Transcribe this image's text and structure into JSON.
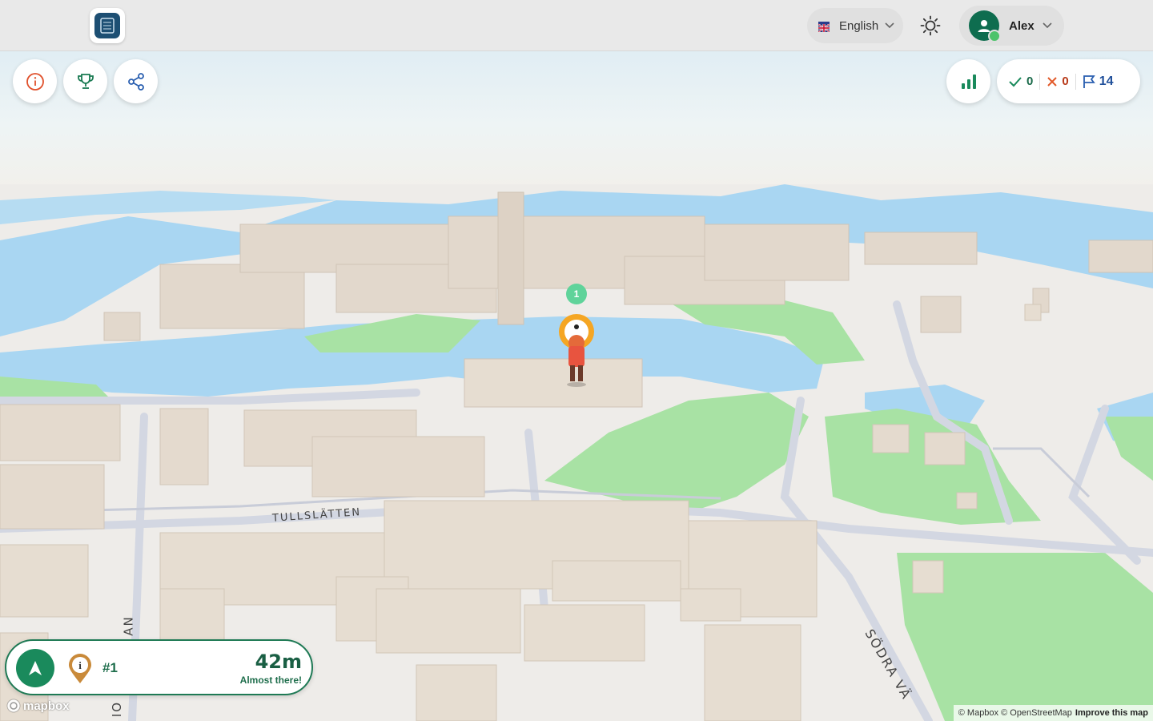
{
  "header": {
    "language_label": "English",
    "user_name": "Alex"
  },
  "toolbar": {
    "info_icon": "info-icon",
    "trophy_icon": "trophy-icon",
    "share_icon": "share-icon"
  },
  "score": {
    "correct": "0",
    "wrong": "0",
    "flags": "14"
  },
  "map": {
    "marker_number": "1",
    "streets": [
      "TULLSLÄTTEN",
      "SÖDRA VÄ",
      "AN",
      "IO"
    ]
  },
  "navigation": {
    "rank": "#1",
    "distance": "42m",
    "status": "Almost there!"
  },
  "footer": {
    "mapbox_logo": "mapbox",
    "attribution": "© Mapbox © OpenStreetMap",
    "improve_link": "Improve this map"
  },
  "colors": {
    "water": "#a9d6f2",
    "park": "#a8e2a4",
    "building": "#e2d8cc",
    "road": "#d3d7e2",
    "brand_green": "#1a8a5c",
    "wrong_red": "#e25a2a",
    "flag_blue": "#2a5fb0"
  }
}
